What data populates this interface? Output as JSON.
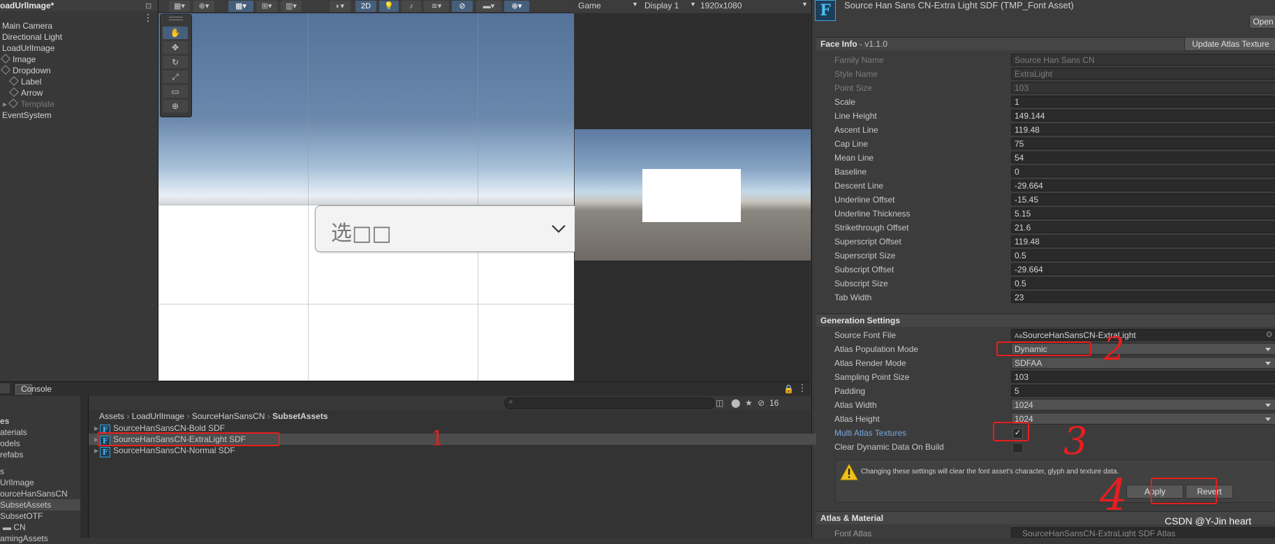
{
  "hierarchy": {
    "title": "oadUrlImage*",
    "items": [
      {
        "label": "Main Camera",
        "icon": "none",
        "dim": false
      },
      {
        "label": "Directional Light",
        "icon": "none",
        "dim": false
      },
      {
        "label": "LoadUrlImage",
        "icon": "none",
        "dim": false
      },
      {
        "label": "Image",
        "icon": "cube-icon",
        "dim": false
      },
      {
        "label": "Dropdown",
        "icon": "cube-icon",
        "dim": false
      },
      {
        "label": "Label",
        "icon": "cube-icon",
        "dim": false
      },
      {
        "label": "Arrow",
        "icon": "cube-icon",
        "dim": false
      },
      {
        "label": "Template",
        "icon": "cube-icon",
        "dim": true
      },
      {
        "label": "EventSystem",
        "icon": "none",
        "dim": false
      }
    ]
  },
  "scene_toolbar": {
    "mode_2d": "2D"
  },
  "scene": {
    "dropdown_text": "选□□"
  },
  "game_toolbar": {
    "view": "Game",
    "display": "Display 1",
    "resolution": "1920x1080"
  },
  "inspector": {
    "title": "Source Han Sans CN-Extra Light SDF (TMP_Font Asset)",
    "open_button": "Open",
    "face_info": {
      "header": "Face Info",
      "version": " - v1.1.0",
      "update_button": "Update Atlas Texture",
      "fields": [
        {
          "label": "Family Name",
          "value": "Source Han Sans CN",
          "dim": true
        },
        {
          "label": "Style Name",
          "value": "ExtraLight",
          "dim": true
        },
        {
          "label": "Point Size",
          "value": "103",
          "dim": true
        },
        {
          "label": "Scale",
          "value": "1",
          "dim": false
        },
        {
          "label": "Line Height",
          "value": "149.144",
          "dim": false
        },
        {
          "label": "Ascent Line",
          "value": "119.48",
          "dim": false
        },
        {
          "label": "Cap Line",
          "value": "75",
          "dim": false
        },
        {
          "label": "Mean Line",
          "value": "54",
          "dim": false
        },
        {
          "label": "Baseline",
          "value": "0",
          "dim": false
        },
        {
          "label": "Descent Line",
          "value": "-29.664",
          "dim": false
        },
        {
          "label": "Underline Offset",
          "value": "-15.45",
          "dim": false
        },
        {
          "label": "Underline Thickness",
          "value": "5.15",
          "dim": false
        },
        {
          "label": "Strikethrough Offset",
          "value": "21.6",
          "dim": false
        },
        {
          "label": "Superscript Offset",
          "value": "119.48",
          "dim": false
        },
        {
          "label": "Superscript Size",
          "value": "0.5",
          "dim": false
        },
        {
          "label": "Subscript Offset",
          "value": "-29.664",
          "dim": false
        },
        {
          "label": "Subscript Size",
          "value": "0.5",
          "dim": false
        },
        {
          "label": "Tab Width",
          "value": "23",
          "dim": false
        }
      ]
    },
    "generation": {
      "header": "Generation Settings",
      "source_font_label": "Source Font File",
      "source_font_value": "SourceHanSansCN-ExtraLight",
      "source_font_prefix": "Aa",
      "population_label": "Atlas Population Mode",
      "population_value": "Dynamic",
      "render_label": "Atlas Render Mode",
      "render_value": "SDFAA",
      "sampling_label": "Sampling Point Size",
      "sampling_value": "103",
      "padding_label": "Padding",
      "padding_value": "5",
      "width_label": "Atlas Width",
      "width_value": "1024",
      "height_label": "Atlas Height",
      "height_value": "1024",
      "multi_label": "Multi Atlas Textures",
      "multi_checked": "✓",
      "clear_label": "Clear Dynamic Data On Build",
      "warning": "Changing these settings will clear the font asset's character, glyph and texture data.",
      "apply_button": "Apply",
      "revert_button": "Revert"
    },
    "atlas": {
      "header": "Atlas & Material",
      "font_atlas_label": "Font Atlas",
      "font_atlas_value": "SourceHanSansCN-ExtraLight SDF Atlas"
    }
  },
  "annotations": [
    "1",
    "2",
    "3",
    "4"
  ],
  "bottom": {
    "console_tab": "Console",
    "filter_count": "16",
    "breadcrumb": [
      "Assets",
      "LoadUrlImage",
      "SourceHanSansCN",
      "SubsetAssets"
    ],
    "folders": [
      "es",
      "aterials",
      "odels",
      "refabs",
      "s",
      "UrlImage",
      "ourceHanSansCN",
      "SubsetAssets",
      "SubsetOTF",
      "CN",
      "amingAssets"
    ],
    "files": [
      {
        "name": "SourceHanSansCN-Bold SDF",
        "selected": false
      },
      {
        "name": "SourceHanSansCN-ExtraLight SDF",
        "selected": true
      },
      {
        "name": "SourceHanSansCN-Normal SDF",
        "selected": false
      }
    ]
  },
  "watermark": "CSDN @Y-Jin heart"
}
